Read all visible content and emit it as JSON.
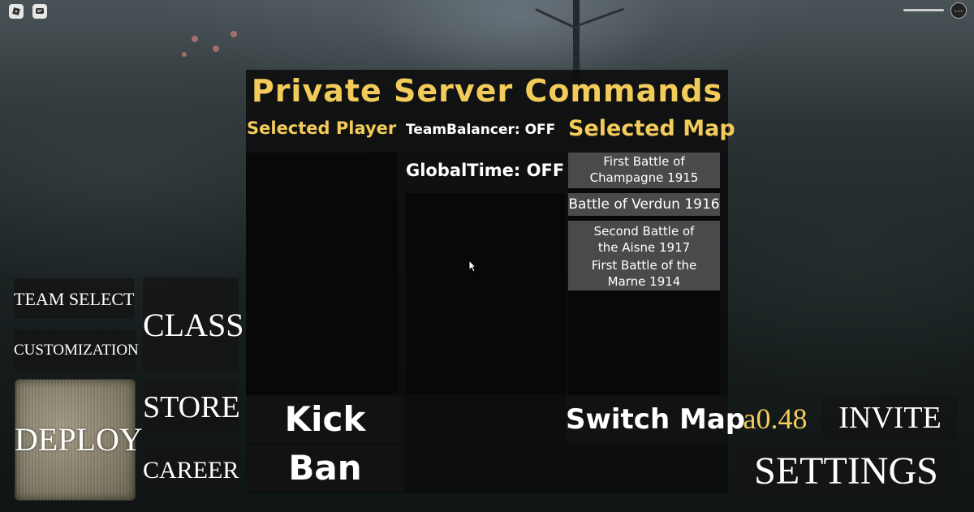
{
  "title": "Private Server Commands",
  "headers": {
    "selected_player": "Selected Player",
    "team_balancer": "TeamBalancer: OFF",
    "selected_map": "Selected Map",
    "global_time": "GlobalTime: OFF"
  },
  "maps": [
    "First Battle of Champagne 1915",
    "Battle of Verdun 1916",
    "Second Battle of the Aisne 1917",
    "First Battle of the Marne 1914"
  ],
  "commands": {
    "kick": "Kick",
    "ban": "Ban",
    "switch_map": "Switch Map"
  },
  "menu_left": {
    "team_select": "TEAM SELECT",
    "class": "CLASS",
    "customization": "CUSTOMIZATION",
    "store": "STORE",
    "deploy": "DEPLOY",
    "career": "CAREER"
  },
  "menu_right": {
    "version": "a0.48",
    "invite": "INVITE",
    "settings": "SETTINGS"
  },
  "colors": {
    "accent_gold": "#f2cb5a",
    "map_item_bg": "#4a4a4a"
  },
  "icons": [
    "roblox-logo-icon",
    "chat-icon",
    "more-options-icon",
    "mouse-cursor-icon"
  ]
}
